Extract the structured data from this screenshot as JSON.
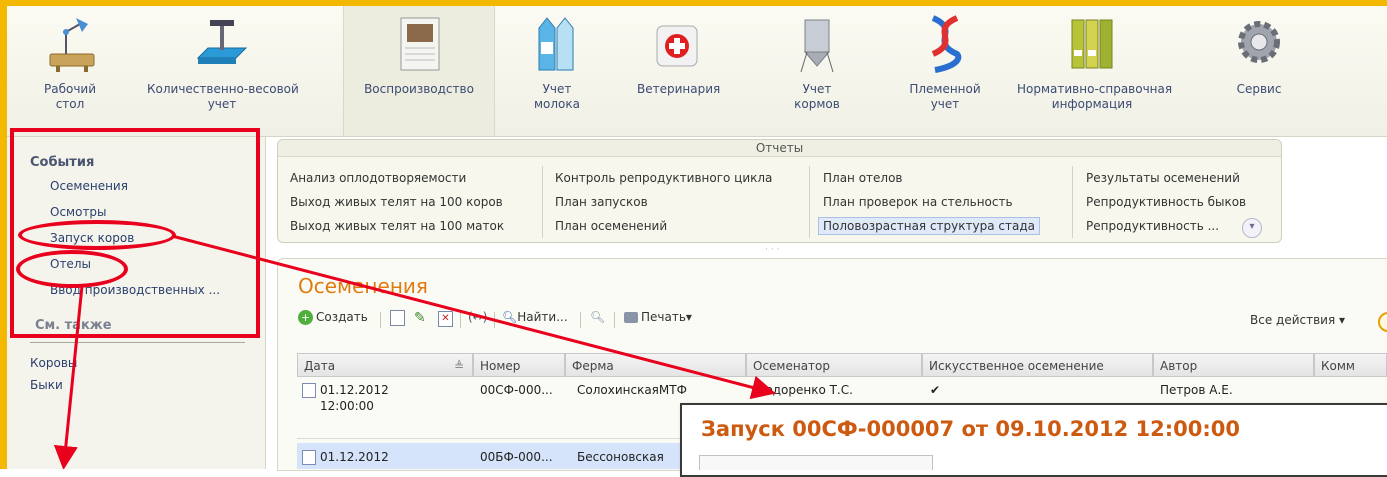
{
  "toolbar": {
    "items": [
      {
        "label1": "Рабочий",
        "label2": "стол"
      },
      {
        "label1": "Количественно-весовой",
        "label2": "учет"
      },
      {
        "label1": "Воспроизводство",
        "label2": ""
      },
      {
        "label1": "Учет",
        "label2": "молока"
      },
      {
        "label1": "Ветеринария",
        "label2": ""
      },
      {
        "label1": "Учет",
        "label2": "кормов"
      },
      {
        "label1": "Племенной",
        "label2": "учет"
      },
      {
        "label1": "Нормативно-справочная",
        "label2": "информация"
      },
      {
        "label1": "Сервис",
        "label2": ""
      }
    ]
  },
  "left_panel": {
    "events_heading": "События",
    "events": [
      "Осеменения",
      "Осмотры",
      "Запуск коров",
      "Отелы",
      "Ввод производственных ..."
    ],
    "see_also_heading": "См. также",
    "see_also": [
      "Коровы",
      "Быки"
    ]
  },
  "reports": {
    "title": "Отчеты",
    "col1": [
      "Анализ оплодотворяемости",
      "Выход живых телят на 100 коров",
      "Выход живых телят на 100 маток"
    ],
    "col2": [
      "Контроль репродуктивного цикла",
      "План запусков",
      "План осеменений"
    ],
    "col3": [
      "План отелов",
      "План проверок на стельность",
      "Половозрастная структура стада"
    ],
    "col4": [
      "Результаты осеменений",
      "Репродуктивность быков",
      "Репродуктивность ..."
    ]
  },
  "main": {
    "title": "Осеменения",
    "create_label": "Создать",
    "find_label": "Найти...",
    "print_label": "Печать",
    "all_actions_label": "Все действия",
    "columns": [
      "Дата",
      "Номер",
      "Ферма",
      "Осеменатор",
      "Искусственное осеменение",
      "Автор",
      "Комм"
    ],
    "rows": [
      {
        "date": "01.12.2012",
        "time": "12:00:00",
        "number": "00СФ-000...",
        "farm": "СолохинскаяМТФ",
        "inseminator": "Федоренко Т.С.",
        "artificial": "✔",
        "author": "Петров А.Е."
      },
      {
        "date": "01.12.2012",
        "time": "",
        "number": "00БФ-000...",
        "farm": "Бессоновская",
        "inseminator": "",
        "artificial": "",
        "author": ""
      }
    ]
  },
  "popup": {
    "title": "Запуск 00СФ-000007 от 09.10.2012 12:00:00"
  },
  "colors": {
    "frame": "#f5b800",
    "annotation": "#e8001c",
    "title_orange": "#e07b10",
    "popup_title": "#cc5a10"
  }
}
